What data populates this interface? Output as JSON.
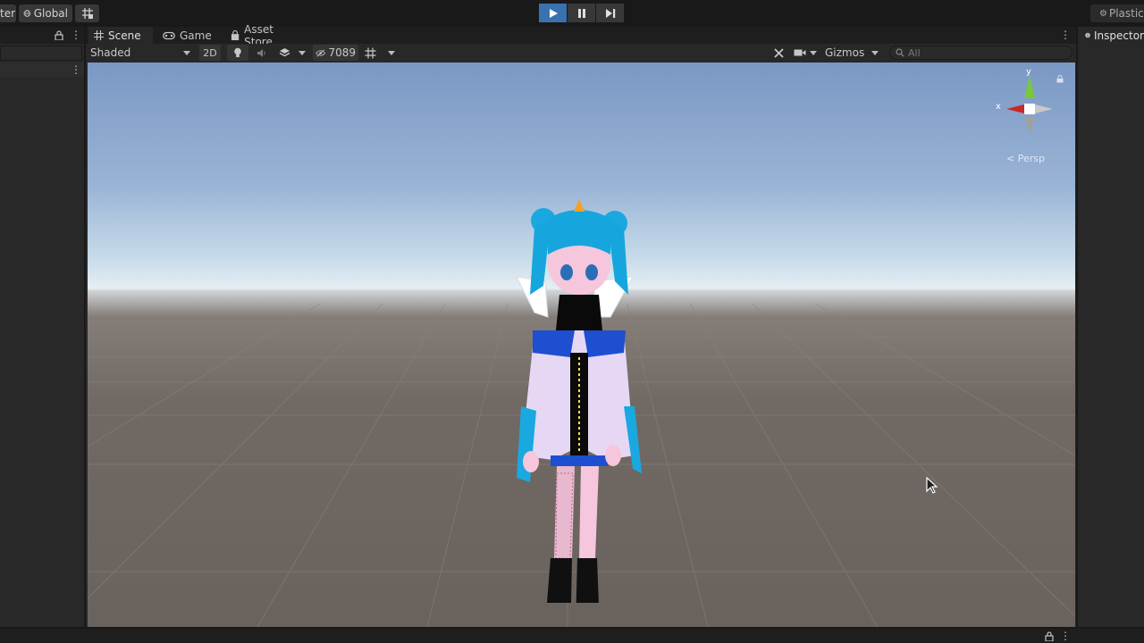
{
  "toolbar": {
    "account_fragment": "ter",
    "global_label": "Global",
    "plastic_label": "Plastic"
  },
  "hierarchy": {},
  "scene_tabs": [
    {
      "label": "Scene",
      "icon": "grid-icon",
      "active": true
    },
    {
      "label": "Game",
      "icon": "gamepad-icon",
      "active": false
    },
    {
      "label": "Asset Store",
      "icon": "bag-icon",
      "active": false
    }
  ],
  "scene_toolbar": {
    "shading_mode": "Shaded",
    "two_d_label": "2D",
    "hidden_count": "7089",
    "gizmos_label": "Gizmos",
    "search_placeholder": "All"
  },
  "gizmo": {
    "y_label": "y",
    "x_label": "x",
    "projection_label": "< Persp"
  },
  "inspector": {
    "tab_label": "Inspector"
  },
  "colors": {
    "play_active": "#3a72b0",
    "sky_top": "#7a98c4",
    "ground": "#6a625d"
  }
}
